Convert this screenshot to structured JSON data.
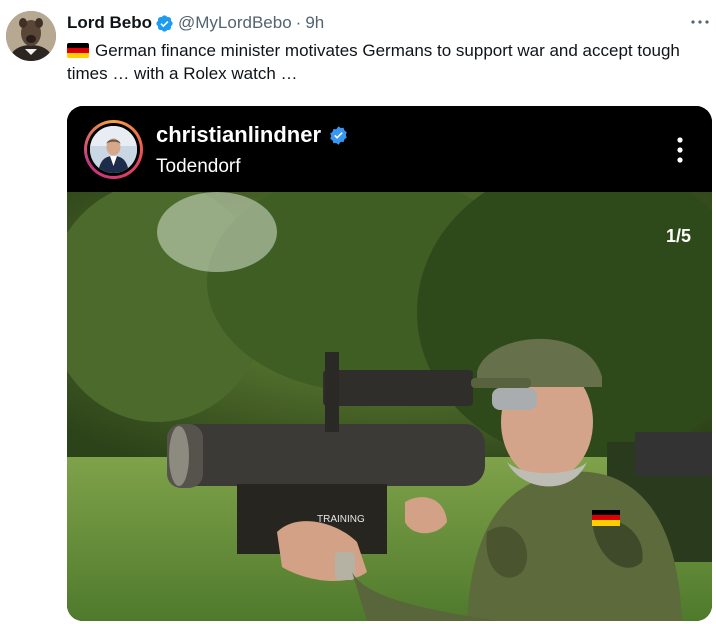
{
  "tweet": {
    "author_name": "Lord Bebo",
    "handle": "@MyLordBebo",
    "separator": "·",
    "time": "9h",
    "more_icon": "ellipsis-icon",
    "text": "German finance minister motivates Germans to support war and accept tough times … with a Rolex watch …",
    "flag": "germany-flag-icon"
  },
  "embed": {
    "username": "christianlindner",
    "location": "Todendorf",
    "slide_counter": "1/5",
    "photo_text": "TRAINING"
  },
  "colors": {
    "verified_blue": "#1d9bf0",
    "ig_verified_blue": "#3897f0",
    "text_primary": "#0f1419",
    "text_secondary": "#536471"
  }
}
